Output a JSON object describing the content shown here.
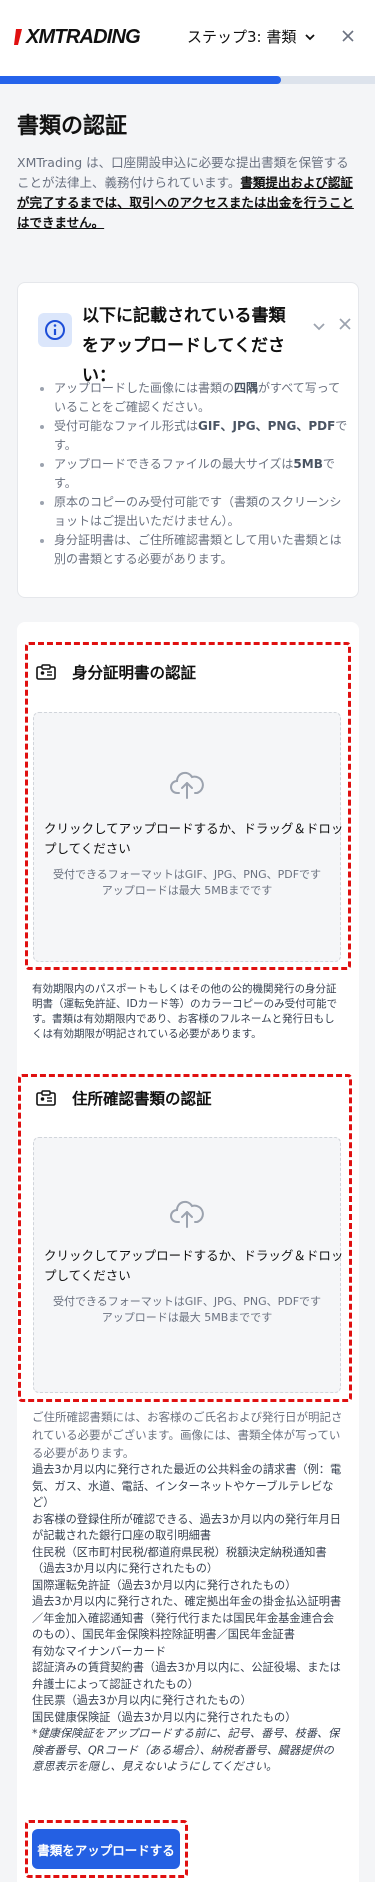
{
  "header": {
    "logo_text": "XMTRADING",
    "step_label": "ステップ3: 書類",
    "progress_percent": 75
  },
  "page": {
    "title": "書類の認証",
    "intro_text": "XMTrading は、口座開設申込に必要な提出書類を保管することが法律上、義務付けられています。",
    "intro_link": "書類提出および認証が完了するまでは、取引へのアクセスまたは出金を行うことはできません。"
  },
  "notice": {
    "title": "以下に記載されている書類をアップロードしてください：",
    "items": [
      {
        "pre": "アップロードした画像には書類の",
        "bold": "四隅",
        "post": "がすべて写っていることをご確認ください。"
      },
      {
        "pre": "受付可能なファイル形式は",
        "bold": "GIF、JPG、PNG、PDF",
        "post": "です。"
      },
      {
        "pre": "アップロードできるファイルの最大サイズは",
        "bold": "5MB",
        "post": "です。"
      },
      {
        "pre": "原本のコピーのみ受付可能です（書類のスクリーンショットはご提出いただけません）。",
        "bold": "",
        "post": ""
      },
      {
        "pre": "身分証明書は、ご住所確認書類として用いた書類とは別の書類とする必要があります。",
        "bold": "",
        "post": ""
      }
    ]
  },
  "id_section": {
    "title": "身分証明書の認証",
    "drop_text": "クリックしてアップロードするか、ドラッグ＆ドロップしてください",
    "formats": "受付できるフォーマットはGIF、JPG、PNG、PDFです",
    "max_size": "アップロードは最大 5MBまでです",
    "description": "有効期限内のパスポートもしくはその他の公的機関発行の身分証明書（運転免許証、IDカード等）のカラーコピーのみ受付可能です。書類は有効期限内であり、お客様のフルネームと発行日もしくは有効期限が明記されている必要があります。"
  },
  "address_section": {
    "title": "住所確認書類の認証",
    "drop_text": "クリックしてアップロードするか、ドラッグ＆ドロップしてください",
    "formats": "受付できるフォーマットはGIF、JPG、PNG、PDFです",
    "max_size": "アップロードは最大 5MBまでです",
    "lead": "ご住所確認書類には、お客様のご氏名および発行日が明記されている必要がございます。画像には、書類全体が写っている必要があります。",
    "items": [
      "過去3か月以内に発行された最近の公共料金の請求書（例：電気、ガス、水道、電話、インターネットやケーブルテレビなど）",
      "お客様の登録住所が確認できる、過去3か月以内の発行年月日が記載された銀行口座の取引明細書",
      "住民税（区市町村民税/都道府県民税）税額決定納税通知書（過去3か月以内に発行されたもの）",
      "国際運転免許証（過去3か月以内に発行されたもの）",
      "過去3か月以内に発行された、確定拠出年金の掛金払込証明書／年金加入確認通知書（発行代行または国民年金基金連合会のもの）、国民年金保険料控除証明書／国民年金証書",
      "有効なマイナンバーカード",
      "認証済みの賃貸契約書（過去3か月以内に、公証役場、または弁護士によって認証されたもの）",
      "住民票（過去3か月以内に発行されたもの）",
      "国民健康保険証（過去3か月以内に発行されたもの）"
    ],
    "note": "*健康保険証をアップロードする前に、記号、番号、枝番、保険者番号、QRコード（ある場合）、納税者番号、臓器提供の意思表示を隠し、見えないようにしてください。"
  },
  "submit_label": "書類をアップロードする",
  "colors": {
    "accent": "#2460e3",
    "highlight": "#e01010"
  }
}
